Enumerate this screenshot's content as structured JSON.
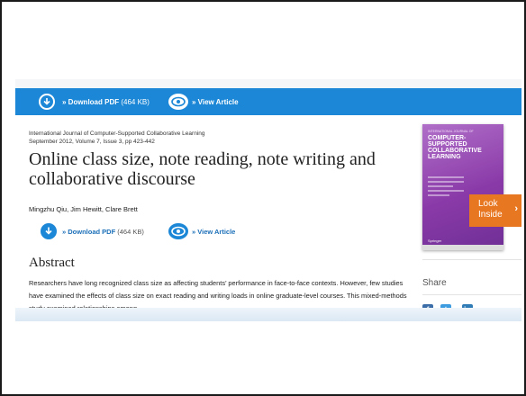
{
  "top_bar": {
    "download_label": "» Download PDF",
    "download_size": "(464 KB)",
    "view_label": "» View Article"
  },
  "article": {
    "journal_name": "International Journal of Computer-Supported Collaborative Learning",
    "issue_info": "September 2012, Volume 7, Issue 3, pp 423-442",
    "title": "Online class size, note reading, note writing and collaborative discourse",
    "authors": "Mingzhu Qiu, Jim Hewitt, Clare Brett",
    "download_label": "» Download PDF",
    "download_size": "(464 KB)",
    "view_label": "» View Article"
  },
  "abstract": {
    "heading": "Abstract",
    "text": "Researchers have long recognized class size as affecting students’ performance in face-to-face contexts. However, few studies have examined the effects of class size on exact reading and writing loads in online graduate-level courses. This mixed-methods study examined relationships among"
  },
  "sidebar": {
    "cover_small": "INTERNATIONAL JOURNAL OF",
    "cover_title": "COMPUTER-SUPPORTED COLLABORATIVE LEARNING",
    "cover_publisher": "Springer",
    "look_inside": "Look Inside",
    "share_label": "Share"
  },
  "colors": {
    "bar_blue": "#1b87d6",
    "link_blue": "#1b6fb8",
    "look_orange": "#e87722",
    "cover_purple": "#8a3aa8"
  }
}
